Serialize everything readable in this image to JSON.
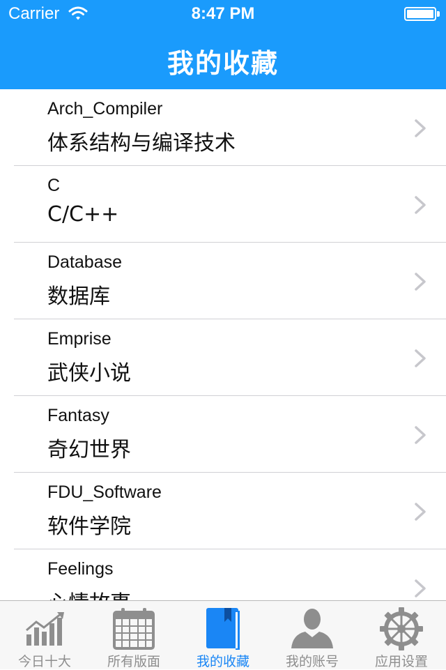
{
  "status_bar": {
    "carrier": "Carrier",
    "time": "8:47 PM"
  },
  "nav": {
    "title": "我的收藏"
  },
  "favorites": [
    {
      "en": "Arch_Compiler",
      "cn": "体系结构与编译技术"
    },
    {
      "en": "C",
      "cn": "C/C++"
    },
    {
      "en": "Database",
      "cn": "数据库"
    },
    {
      "en": "Emprise",
      "cn": "武侠小说"
    },
    {
      "en": "Fantasy",
      "cn": "奇幻世界"
    },
    {
      "en": "FDU_Software",
      "cn": "软件学院"
    },
    {
      "en": "Feelings",
      "cn": "心情故事"
    }
  ],
  "tabbar": {
    "active_index": 2,
    "tabs": [
      {
        "label": "今日十大",
        "icon": "chart-icon"
      },
      {
        "label": "所有版面",
        "icon": "calendar-icon"
      },
      {
        "label": "我的收藏",
        "icon": "book-icon"
      },
      {
        "label": "我的账号",
        "icon": "person-icon"
      },
      {
        "label": "应用设置",
        "icon": "gear-icon"
      }
    ]
  },
  "colors": {
    "header": "#1a9bfc",
    "tab_active": "#1a86f5",
    "tab_inactive": "#8e8e8e"
  }
}
